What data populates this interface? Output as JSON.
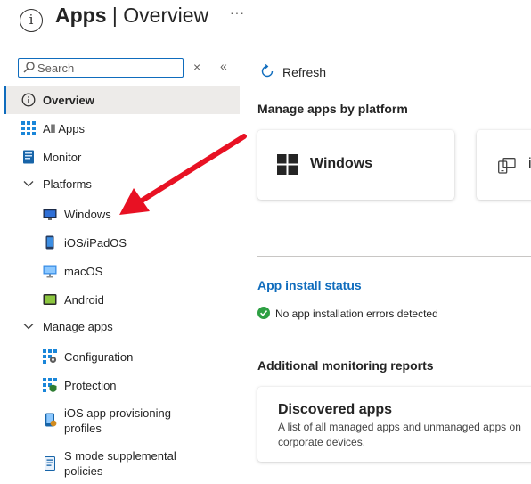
{
  "header": {
    "title_bold": "Apps",
    "title_separator": "|",
    "title_rest": "Overview",
    "more": "···",
    "info_glyph": "i"
  },
  "sidebar": {
    "search": {
      "placeholder": "Search",
      "clear": "×",
      "collapse": "«"
    },
    "items": [
      {
        "label": "Overview"
      },
      {
        "label": "All Apps"
      },
      {
        "label": "Monitor"
      },
      {
        "label": "Platforms"
      },
      {
        "label": "Windows"
      },
      {
        "label": "iOS/iPadOS"
      },
      {
        "label": "macOS"
      },
      {
        "label": "Android"
      },
      {
        "label": "Manage apps"
      },
      {
        "label": "Configuration"
      },
      {
        "label": "Protection"
      },
      {
        "label_line1": "iOS app provisioning",
        "label_line2": "profiles"
      },
      {
        "label_line1": "S mode supplemental",
        "label_line2": "policies"
      }
    ]
  },
  "main": {
    "refresh_label": "Refresh",
    "platform_section_title": "Manage apps by platform",
    "platform_cards": [
      {
        "label": "Windows"
      },
      {
        "label": "i"
      }
    ],
    "install_status_title": "App install status",
    "install_status_text": "No app installation errors detected",
    "monitoring_title": "Additional monitoring reports",
    "discovered": {
      "title": "Discovered apps",
      "description": "A list of all managed apps and unmanaged apps on corporate devices."
    }
  },
  "colors": {
    "accent": "#0f6cbd",
    "annotation_arrow": "#e81123",
    "success": "#2ea043"
  }
}
